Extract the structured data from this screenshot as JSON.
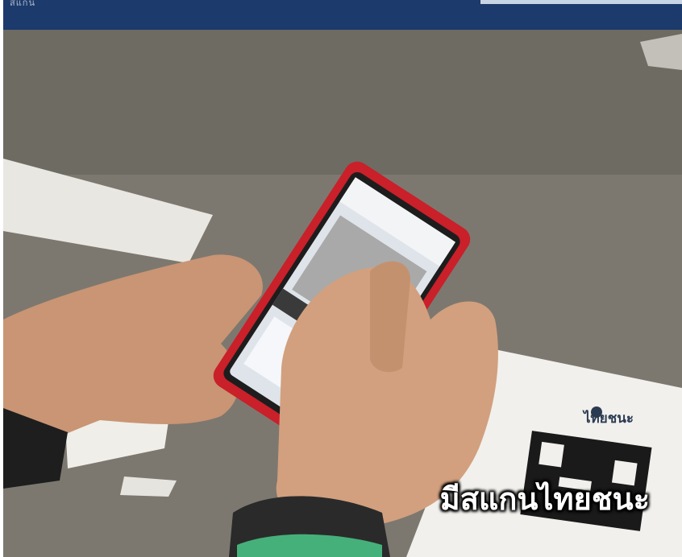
{
  "banner": {
    "faint_text": "สแกน"
  },
  "caption": {
    "text": "มีสแกนไทยชนะ"
  },
  "poster": {
    "label": "ไทยชนะ"
  },
  "colors": {
    "banner": "#1c3a6b",
    "phone_case": "#c9202a"
  }
}
